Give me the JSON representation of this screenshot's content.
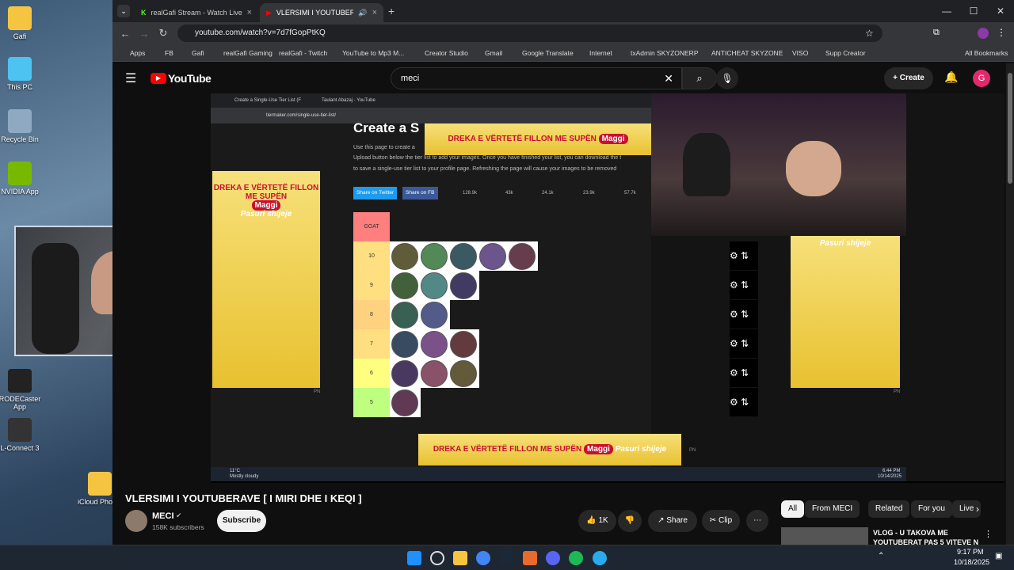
{
  "desktop": {
    "icons": [
      {
        "label": "Gafi",
        "color": "#f5c542"
      },
      {
        "label": "This PC",
        "color": "#4cc3f0"
      },
      {
        "label": "Recycle Bin",
        "color": "#8fa9c2"
      },
      {
        "label": "NVIDIA App",
        "color": "#76b900"
      },
      {
        "label": "RODECaster App",
        "color": "#222222"
      },
      {
        "label": "L-Connect 3",
        "color": "#333333"
      },
      {
        "label": "iCloud Photos",
        "color": "#f5c542"
      }
    ]
  },
  "tabs": [
    {
      "title": "realGafi Stream - Watch Live o"
    },
    {
      "title": "VLERSIMI I YOUTUBERAVE ["
    }
  ],
  "address": {
    "url": "youtube.com/watch?v=7d7fGopPtKQ"
  },
  "bookmarks": [
    "Apps",
    "FB",
    "Gafi",
    "realGafi Gaming",
    "realGafi - Twitch",
    "YouTube to Mp3 M...",
    "Creator Studio",
    "Gmail",
    "Google Translate",
    "Internet",
    "txAdmin SKYZONERP",
    "ANTICHEAT SKYZONE",
    "VISO",
    "Supp Creator",
    "All Bookmarks"
  ],
  "yt": {
    "logo": "YouTube",
    "search_value": "meci",
    "create_label": "Create",
    "avatar_letter": "G"
  },
  "stream": {
    "inner_tabs": [
      "Create a Single-Use Tier List (F",
      "Taulant Abazaj - YouTube"
    ],
    "inner_url": "tiermaker.com/single-use-tier-list/",
    "page_heading": "Create a S",
    "intro_line1": "Use this page to create a",
    "intro_line2": "Upload button below the tier list to add your images. Once you have finished your list, you can download the t",
    "intro_line3": "to save a single-use tier list to your profile page. Refreshing the page will cause your images to be removed",
    "share_twitter": "Share on Twitter",
    "share_fb": "Share on FB",
    "reactions": [
      "128.9k",
      "43k",
      "24.1k",
      "23.9k",
      "57.7k"
    ],
    "tiers": [
      "GOAT",
      "10",
      "9",
      "8",
      "7",
      "6",
      "5"
    ],
    "tier_colors": [
      "#ff7f7f",
      "#ffdf7f",
      "#ffdf7f",
      "#ffd27f",
      "#ffdf7f",
      "#ffff7f",
      "#bfff7f"
    ],
    "tier_counts": [
      0,
      5,
      3,
      2,
      3,
      3,
      1
    ],
    "ad_text": "DREKA E VËRTETË FILLON ME SUPËN",
    "ad_brand": "Maggi",
    "ad_tagline": "Pasuri shijeje",
    "ad_mark": "PN",
    "inner_taskbar": {
      "temp": "11°C",
      "weather": "Mostly cloudy",
      "time": "6:44 PM",
      "date": "10/14/2025"
    }
  },
  "video": {
    "title": "VLERSIMI I YOUTUBERAVE [ I MIRI DHE I KEQI ]",
    "channel": "MECI",
    "subscribers": "158K subscribers",
    "subscribe_label": "Subscribe",
    "likes": "1K",
    "share_label": "Share",
    "clip_label": "Clip"
  },
  "chips": [
    "All",
    "From MECI",
    "Related",
    "For you",
    "Live"
  ],
  "recommended": {
    "title_line1": "VLOG - U TAKOVA ME",
    "title_line2": "YOUTUBERAT PAS 5 VITEVE N"
  },
  "taskbar": {
    "time": "9:17 PM",
    "date": "10/18/2025"
  }
}
